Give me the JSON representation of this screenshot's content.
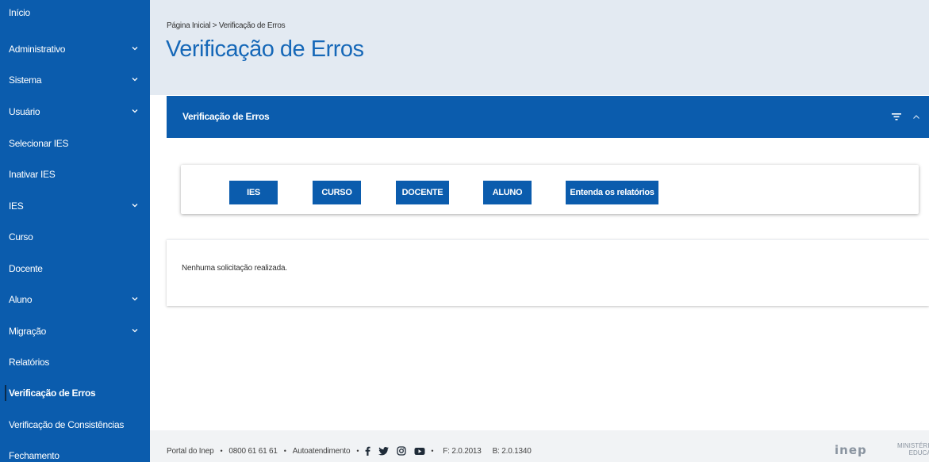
{
  "sidebar": {
    "items": [
      {
        "label": "Início",
        "has_submenu": false,
        "active": false
      },
      {
        "label": "Administrativo",
        "has_submenu": true,
        "active": false
      },
      {
        "label": "Sistema",
        "has_submenu": true,
        "active": false
      },
      {
        "label": "Usuário",
        "has_submenu": true,
        "active": false
      },
      {
        "label": "Selecionar IES",
        "has_submenu": false,
        "active": false
      },
      {
        "label": "Inativar IES",
        "has_submenu": false,
        "active": false
      },
      {
        "label": "IES",
        "has_submenu": true,
        "active": false
      },
      {
        "label": "Curso",
        "has_submenu": false,
        "active": false
      },
      {
        "label": "Docente",
        "has_submenu": false,
        "active": false
      },
      {
        "label": "Aluno",
        "has_submenu": true,
        "active": false
      },
      {
        "label": "Migração",
        "has_submenu": true,
        "active": false
      },
      {
        "label": "Relatórios",
        "has_submenu": false,
        "active": false
      },
      {
        "label": "Verificação de Erros",
        "has_submenu": false,
        "active": true
      },
      {
        "label": "Verificação de Consistências",
        "has_submenu": false,
        "active": false
      },
      {
        "label": "Fechamento",
        "has_submenu": false,
        "active": false
      }
    ]
  },
  "breadcrumb": {
    "home": "Página Inicial",
    "separator": ">",
    "current": "Verificação de Erros"
  },
  "page": {
    "title": "Verificação de Erros"
  },
  "card": {
    "title": "Verificação de Erros",
    "filter_icon": "filter-icon",
    "collapse_icon": "chevron-up-icon",
    "buttons": {
      "ies": "IES",
      "curso": "CURSO",
      "docente": "DOCENTE",
      "aluno": "ALUNO",
      "entenda": "Entenda os relatórios"
    },
    "empty_message": "Nenhuma solicitação realizada."
  },
  "footer": {
    "portal": "Portal do Inep",
    "phone": "0800 61 61 61",
    "autoatendimento": "Autoatendimento",
    "version_f": "F: 2.0.2013",
    "version_b": "B: 2.0.1340",
    "logo_text": "inep",
    "ministerio_line1": "MINISTÉRIO DA",
    "ministerio_line2": "EDUCAÇÃO",
    "social_icons": [
      "facebook-icon",
      "twitter-icon",
      "instagram-icon",
      "youtube-icon"
    ]
  },
  "colors": {
    "primary": "#0b5cad",
    "title_blue": "#1668b8",
    "header_band": "#e3eaf2",
    "footer_bg": "#f1f3f5"
  }
}
